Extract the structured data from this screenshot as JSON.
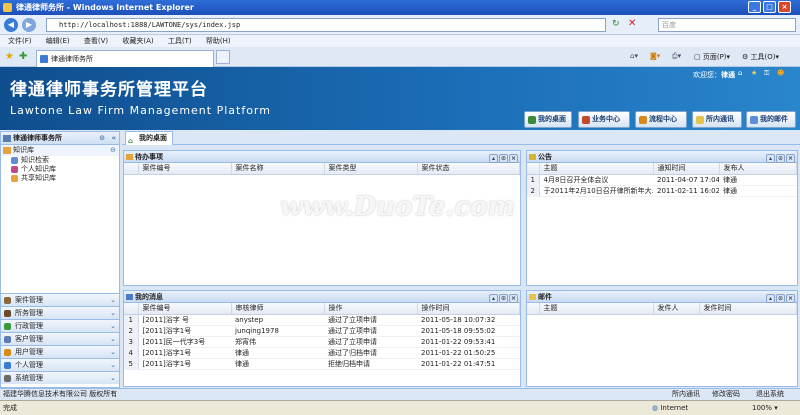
{
  "window": {
    "title": "律通律师务所 - Windows Internet Explorer"
  },
  "address": {
    "url": "http://localhost:1888/LAWTONE/sys/index.jsp",
    "search_placeholder": "百度"
  },
  "menu": [
    "文件(F)",
    "编辑(E)",
    "查看(V)",
    "收藏夹(A)",
    "工具(T)",
    "帮助(H)"
  ],
  "ie_toolbar": {
    "page": "页面(P)",
    "tools": "工具(O)"
  },
  "browser_tab": {
    "label": "律通律师务所"
  },
  "banner": {
    "title": "律通律师事务所管理平台",
    "subtitle": "Lawtone Law Firm Management Platform",
    "welcome_prefix": "欢迎您：",
    "welcome_user": "律通"
  },
  "top_nav": [
    {
      "label": "我的桌面",
      "icon": "house-icon"
    },
    {
      "label": "业务中心",
      "icon": "gears-icon"
    },
    {
      "label": "流程中心",
      "icon": "flow-icon"
    },
    {
      "label": "所内通讯",
      "icon": "chat-icon"
    },
    {
      "label": "我的邮件",
      "icon": "mail-icon"
    }
  ],
  "left": {
    "title": "律通律师事务所",
    "group": "知识库",
    "items": [
      "知识检索",
      "个人知识库",
      "共享知识库"
    ],
    "sections": [
      "案件管理",
      "所务管理",
      "行政管理",
      "客户管理",
      "用户管理",
      "个人管理",
      "系统管理"
    ]
  },
  "main_tab": {
    "label": "我的桌面"
  },
  "todo": {
    "title": "待办事项",
    "columns": [
      "案件编号",
      "案件名称",
      "案件类型",
      "案件状态"
    ]
  },
  "notice": {
    "title": "公告",
    "columns": [
      "主题",
      "通知时间",
      "发布人"
    ],
    "rows": [
      {
        "n": "1",
        "subject": "4月8日召开全体会议",
        "time": "2011-04-07 17:04:40",
        "by": "律通"
      },
      {
        "n": "2",
        "subject": "于2011年2月10日召开律所新年大...",
        "time": "2011-02-11 16:02:52",
        "by": "律通"
      }
    ]
  },
  "messages": {
    "title": "我的消息",
    "columns": [
      "案件编号",
      "审核律师",
      "操作",
      "操作时间"
    ],
    "rows": [
      {
        "n": "1",
        "case": "[2011]浴字 号",
        "lawyer": "anystep",
        "op": "通过了立项申请",
        "time": "2011-05-18 10:07:32"
      },
      {
        "n": "2",
        "case": "[2011]浴字1号",
        "lawyer": "junqing1978",
        "op": "通过了立项申请",
        "time": "2011-05-18 09:55:02"
      },
      {
        "n": "3",
        "case": "[2011]民一代字3号",
        "lawyer": "郑宵伟",
        "op": "通过了立项申请",
        "time": "2011-01-22 09:53:41"
      },
      {
        "n": "4",
        "case": "[2011]浴字1号",
        "lawyer": "律通",
        "op": "通过了归档申请",
        "time": "2011-01-22 01:50:25"
      },
      {
        "n": "5",
        "case": "[2011]浴字1号",
        "lawyer": "律通",
        "op": "拒绝归档申请",
        "time": "2011-01-22 01:47:51"
      }
    ]
  },
  "mail": {
    "title": "邮件",
    "columns": [
      "主题",
      "发件人",
      "发件时间"
    ]
  },
  "footer": {
    "copyright": "福建华腾信息技术有限公司  版权所有",
    "links": [
      "所内通讯",
      "修改密码",
      "退出系统"
    ]
  },
  "status": {
    "left": "完成",
    "zone": "Internet",
    "zoom": "100%"
  },
  "watermark": "www.DuoTe.com",
  "colors": {
    "banner": "#1c6fb8",
    "panel_border": "#99bbe8"
  }
}
